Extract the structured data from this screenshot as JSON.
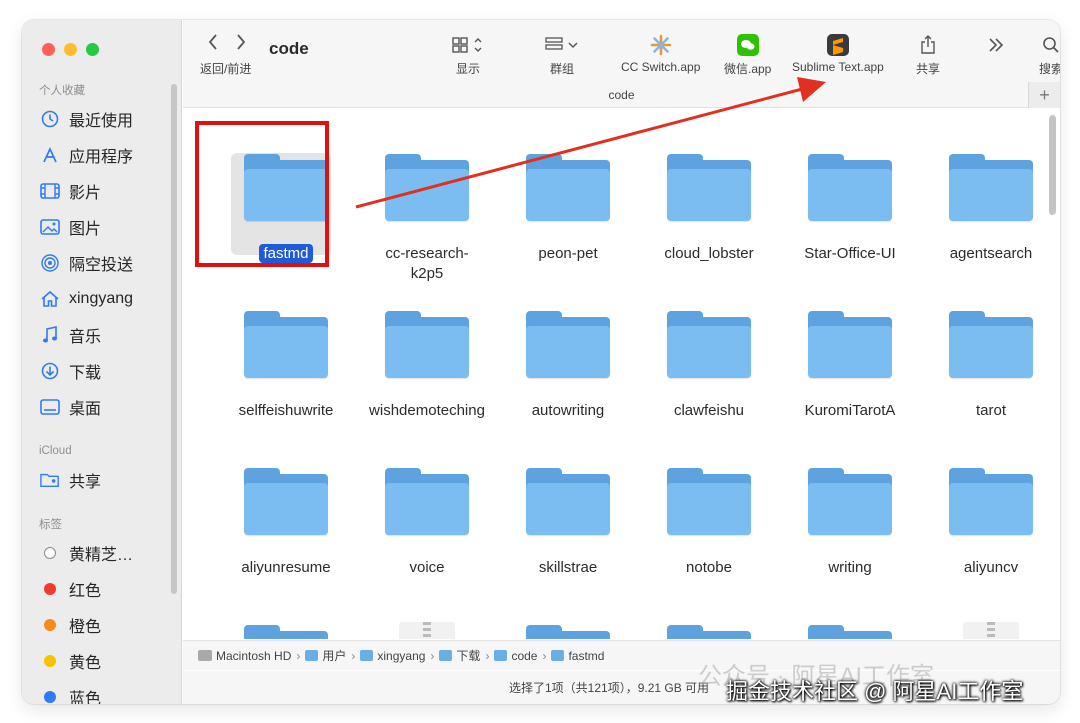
{
  "window": {
    "title": "code"
  },
  "sidebar": {
    "favorites_header": "个人收藏",
    "favorites": [
      {
        "label": "最近使用",
        "icon": "clock-icon"
      },
      {
        "label": "应用程序",
        "icon": "apps-icon"
      },
      {
        "label": "影片",
        "icon": "film-icon"
      },
      {
        "label": "图片",
        "icon": "photo-icon"
      },
      {
        "label": "隔空投送",
        "icon": "airdrop-icon"
      },
      {
        "label": "xingyang",
        "icon": "home-icon"
      },
      {
        "label": "音乐",
        "icon": "music-icon"
      },
      {
        "label": "下载",
        "icon": "download-icon"
      },
      {
        "label": "桌面",
        "icon": "desktop-icon"
      }
    ],
    "icloud_header": "iCloud",
    "icloud": [
      {
        "label": "共享",
        "icon": "shared-folder-icon"
      }
    ],
    "tags_header": "标签",
    "tags": [
      {
        "label": "黄精芝…",
        "color": "#ffffff"
      },
      {
        "label": "红色",
        "color": "#f03b30"
      },
      {
        "label": "橙色",
        "color": "#f58a1f"
      },
      {
        "label": "黄色",
        "color": "#f6c300"
      },
      {
        "label": "蓝色",
        "color": "#2f7bf5"
      }
    ]
  },
  "toolbar": {
    "nav_label": "返回/前进",
    "view_label": "显示",
    "group_label": "群组",
    "app1_label": "CC Switch.app",
    "app2_label": "微信.app",
    "app3_label": "Sublime Text.app",
    "share_label": "共享",
    "search_label": "搜索",
    "path_title": "code"
  },
  "items": [
    {
      "name": "fastmd",
      "type": "folder",
      "selected": true
    },
    {
      "name": "cc-research-\nk2p5",
      "type": "folder"
    },
    {
      "name": "peon-pet",
      "type": "folder"
    },
    {
      "name": "cloud_lobster",
      "type": "folder"
    },
    {
      "name": "Star-Office-UI",
      "type": "folder"
    },
    {
      "name": "agentsearch",
      "type": "folder"
    },
    {
      "name": "selffeishuwrite",
      "type": "folder"
    },
    {
      "name": "wishdemoteching",
      "type": "folder"
    },
    {
      "name": "autowriting",
      "type": "folder"
    },
    {
      "name": "clawfeishu",
      "type": "folder"
    },
    {
      "name": "KuromiTarotA",
      "type": "folder"
    },
    {
      "name": "tarot",
      "type": "folder"
    },
    {
      "name": "aliyunresume",
      "type": "folder"
    },
    {
      "name": "voice",
      "type": "folder"
    },
    {
      "name": "skillstrae",
      "type": "folder"
    },
    {
      "name": "notobe",
      "type": "folder"
    },
    {
      "name": "writing",
      "type": "folder"
    },
    {
      "name": "aliyuncv",
      "type": "folder"
    },
    {
      "name": "",
      "type": "folder"
    },
    {
      "name": "",
      "type": "zip"
    },
    {
      "name": "",
      "type": "folder"
    },
    {
      "name": "",
      "type": "folder"
    },
    {
      "name": "",
      "type": "folder"
    },
    {
      "name": "",
      "type": "zip"
    }
  ],
  "pathbar": {
    "segments": [
      "Macintosh HD",
      "用户",
      "xingyang",
      "下载",
      "code",
      "fastmd"
    ]
  },
  "status": {
    "text": "选择了1项（共121项），9.21 GB 可用"
  },
  "watermark": {
    "line1": "公众号 · 阿星AI工作室",
    "line2": "掘金技术社区 @ 阿星AI工作室"
  },
  "colors": {
    "selection": "#1f5bd6",
    "folder": "#7bbdf1",
    "highlight_box": "#e01010",
    "arrow": "#e03020"
  }
}
